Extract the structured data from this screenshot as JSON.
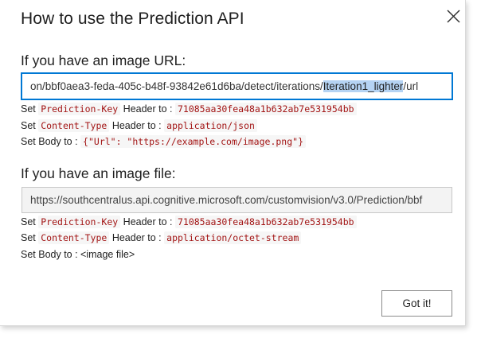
{
  "dialog": {
    "title": "How to use the Prediction API",
    "close_icon": "close-icon"
  },
  "image_url_section": {
    "heading": "If you have an image URL:",
    "url_before_selection": "on/bbf0aea3-feda-405c-b48f-93842e61d6ba/detect/iterations/",
    "url_selected": "Iteration1_lighter",
    "url_after_selection": "/url",
    "lines": [
      {
        "prefix": "Set ",
        "key": "Prediction-Key",
        "mid": " Header to : ",
        "value": "71085aa30fea48a1b632ab7e531954bb"
      },
      {
        "prefix": "Set ",
        "key": "Content-Type",
        "mid": " Header to : ",
        "value": "application/json"
      }
    ],
    "body_label": "Set Body to : ",
    "body_value": "{\"Url\": \"https://example.com/image.png\"}"
  },
  "image_file_section": {
    "heading": "If you have an image file:",
    "url": "https://southcentralus.api.cognitive.microsoft.com/customvision/v3.0/Prediction/bbf",
    "lines": [
      {
        "prefix": "Set ",
        "key": "Prediction-Key",
        "mid": " Header to : ",
        "value": "71085aa30fea48a1b632ab7e531954bb"
      },
      {
        "prefix": "Set ",
        "key": "Content-Type",
        "mid": " Header to : ",
        "value": "application/octet-stream"
      }
    ],
    "body_text": "Set Body to : <image file>"
  },
  "footer": {
    "got_it_label": "Got it!"
  },
  "colors": {
    "accent": "#0078d4",
    "code_text": "#a31515",
    "selection": "#b5d3f3"
  }
}
